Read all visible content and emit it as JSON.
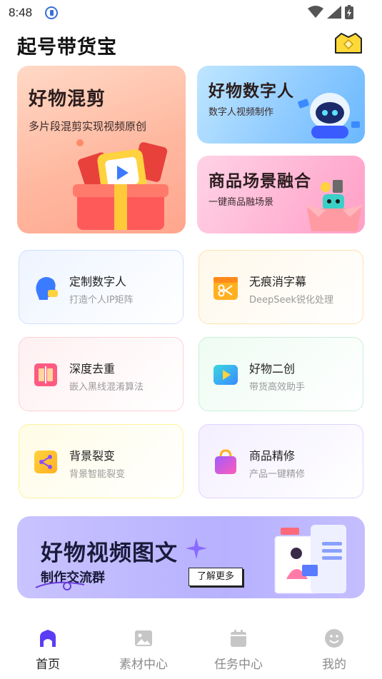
{
  "status": {
    "time": "8:48"
  },
  "header": {
    "title": "起号带货宝"
  },
  "hero": {
    "mix": {
      "title": "好物混剪",
      "subtitle": "多片段混剪实现视频原创"
    },
    "digital": {
      "title": "好物数字人",
      "subtitle": "数字人视频制作"
    },
    "scene": {
      "title": "商品场景融合",
      "subtitle": "一键商品融场景"
    }
  },
  "tools": [
    {
      "title": "定制数字人",
      "subtitle": "打造个人IP矩阵",
      "icon": "avatar-head-icon"
    },
    {
      "title": "无痕消字幕",
      "subtitle": "DeepSeek锐化处理",
      "icon": "scissors-clapper-icon"
    },
    {
      "title": "深度去重",
      "subtitle": "嵌入黑线混淆算法",
      "icon": "split-columns-icon"
    },
    {
      "title": "好物二创",
      "subtitle": "带货高效助手",
      "icon": "play-icon"
    },
    {
      "title": "背景裂变",
      "subtitle": "背景智能裂变",
      "icon": "share-icon"
    },
    {
      "title": "商品精修",
      "subtitle": "产品一键精修",
      "icon": "shopping-bag-icon"
    }
  ],
  "banner": {
    "title": "好物视频图文",
    "subtitle": "制作交流群",
    "button": "了解更多"
  },
  "nav": [
    {
      "label": "首页",
      "icon": "home-icon",
      "active": true
    },
    {
      "label": "素材中心",
      "icon": "image-icon"
    },
    {
      "label": "任务中心",
      "icon": "calendar-icon"
    },
    {
      "label": "我的",
      "icon": "smiley-icon"
    }
  ],
  "colors": {
    "accent": "#5b3df5",
    "nav_inactive": "#c6c6c6"
  }
}
